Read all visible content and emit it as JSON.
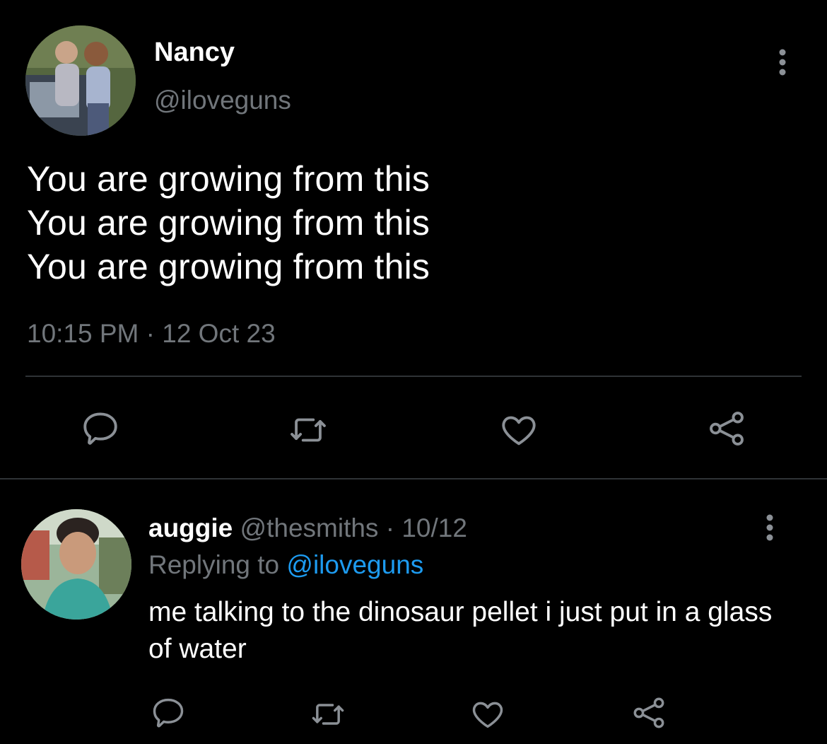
{
  "tweet": {
    "author_name": "Nancy",
    "author_handle": "@iloveguns",
    "lines": [
      "You are growing from this",
      "You are growing from this",
      "You are growing from this"
    ],
    "timestamp": "10:15 PM · 12 Oct 23",
    "icons": [
      "more-vertical-icon",
      "reply-icon",
      "retweet-icon",
      "like-icon",
      "share-icon"
    ]
  },
  "reply": {
    "author_name": "auggie",
    "author_handle": "@thesmiths",
    "separator": "·",
    "date": "10/12",
    "replying_prefix": "Replying to",
    "replying_handle": "@iloveguns",
    "text": "me talking to the dinosaur pellet i just put in a glass of water",
    "icons": [
      "more-vertical-icon",
      "reply-icon",
      "retweet-icon",
      "like-icon",
      "share-icon"
    ]
  },
  "colors": {
    "background": "#000000",
    "text": "#ffffff",
    "muted": "#71767b",
    "link": "#1d9bf0",
    "divider": "#2f3336"
  }
}
